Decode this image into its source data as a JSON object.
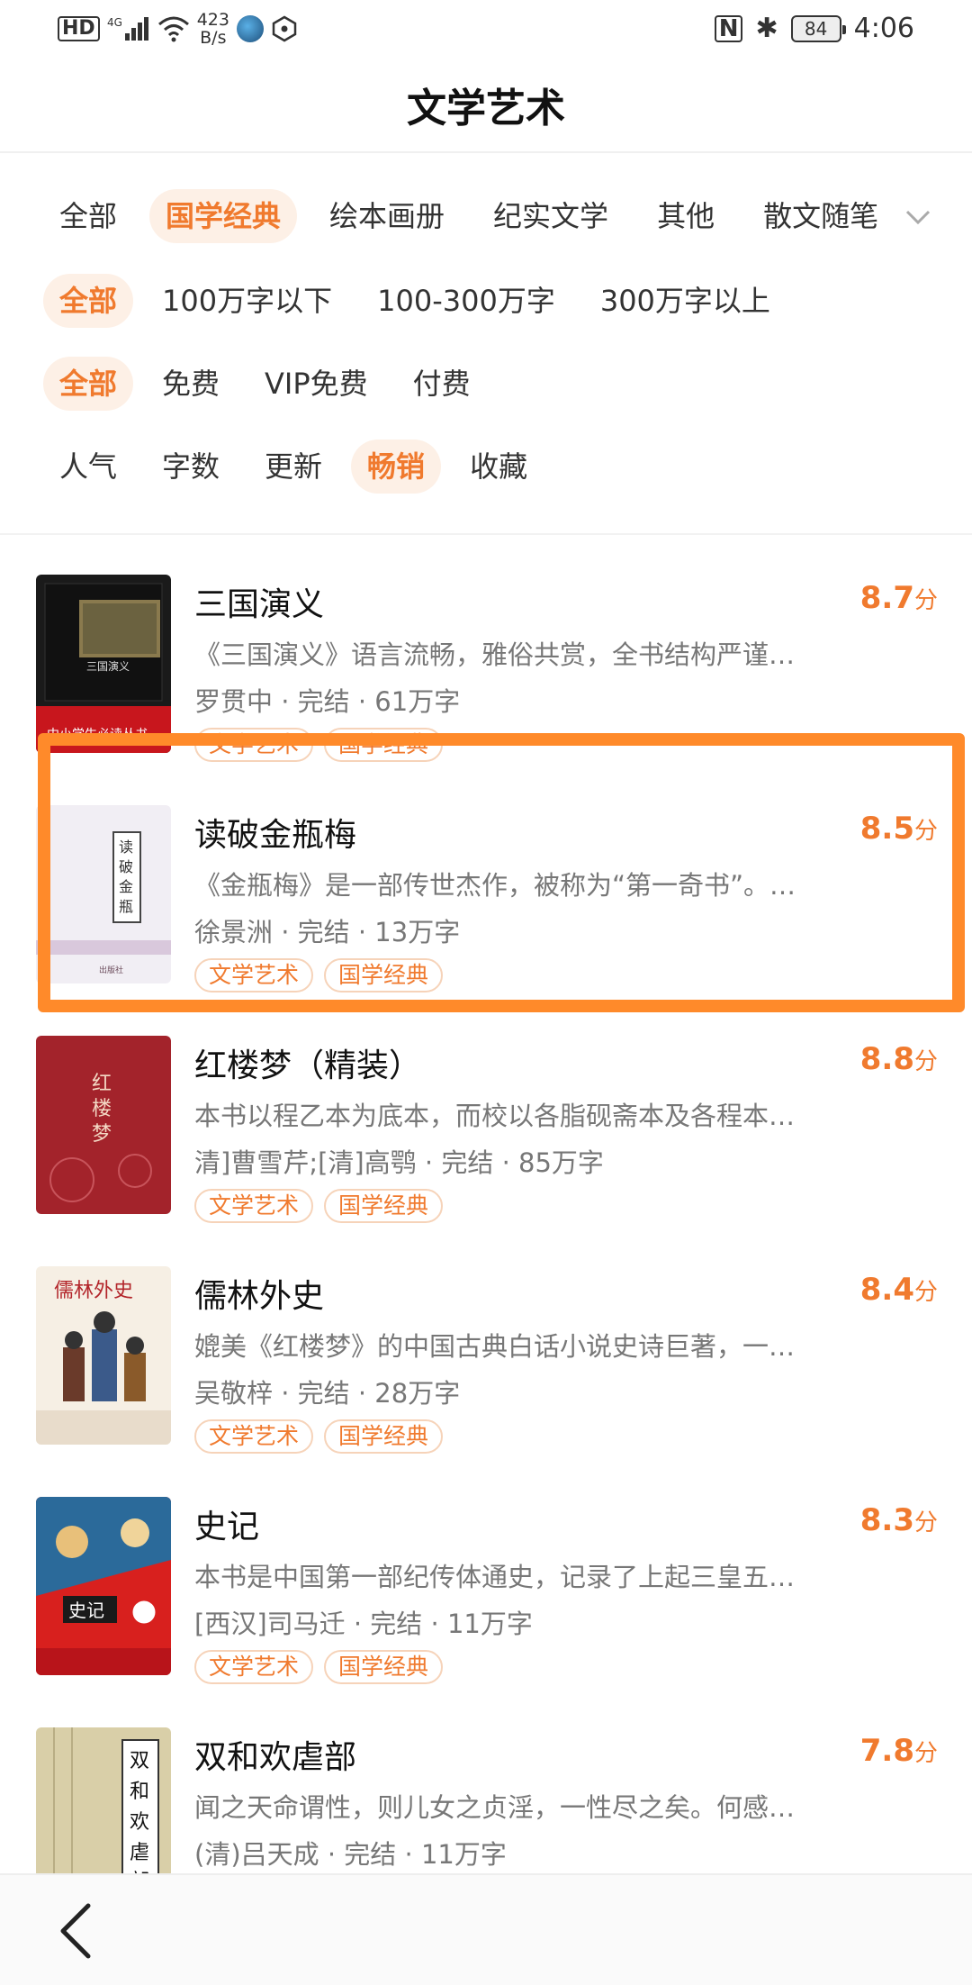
{
  "status_bar": {
    "network_badge": "HD",
    "network_type": "4G",
    "speed_value": "423",
    "speed_unit": "B/s",
    "nfc_label": "N",
    "bluetooth_glyph": "✱",
    "battery_level": "84",
    "time": "4:06"
  },
  "header": {
    "title": "文学艺术"
  },
  "filters": {
    "category": [
      "全部",
      "国学经典",
      "绘本画册",
      "纪实文学",
      "其他",
      "散文随笔"
    ],
    "word_count": [
      "全部",
      "100万字以下",
      "100-300万字",
      "300万字以上"
    ],
    "price": [
      "全部",
      "免费",
      "VIP免费",
      "付费"
    ],
    "sort": [
      "人气",
      "字数",
      "更新",
      "畅销",
      "收藏"
    ]
  },
  "books": [
    {
      "title": "三国演义",
      "score": "8.7",
      "score_unit": "分",
      "desc": "《三国演义》语言流畅，雅俗共赏，全书结构严谨…",
      "meta": "罗贯中 · 完结 · 61万字",
      "tags": [
        "文学艺术",
        "国学经典"
      ]
    },
    {
      "title": "读破金瓶梅",
      "score": "8.5",
      "score_unit": "分",
      "desc": "《金瓶梅》是一部传世杰作，被称为“第一奇书”。…",
      "meta": "徐景洲 · 完结 · 13万字",
      "tags": [
        "文学艺术",
        "国学经典"
      ]
    },
    {
      "title": "红楼梦（精装）",
      "score": "8.8",
      "score_unit": "分",
      "desc": "本书以程乙本为底本，而校以各脂砚斋本及各程本…",
      "meta": "清]曹雪芹;[清]高鹗 · 完结 · 85万字",
      "tags": [
        "文学艺术",
        "国学经典"
      ]
    },
    {
      "title": "儒林外史",
      "score": "8.4",
      "score_unit": "分",
      "desc": "媲美《红楼梦》的中国古典白话小说史诗巨著，一…",
      "meta": "吴敬梓 · 完结 · 28万字",
      "tags": [
        "文学艺术",
        "国学经典"
      ]
    },
    {
      "title": "史记",
      "score": "8.3",
      "score_unit": "分",
      "desc": "本书是中国第一部纪传体通史，记录了上起三皇五…",
      "meta": "[西汉]司马迁 · 完结 · 11万字",
      "tags": [
        "文学艺术",
        "国学经典"
      ]
    },
    {
      "title": "双和欢虐部",
      "score": "7.8",
      "score_unit": "分",
      "desc": "闻之天命谓性，则儿女之贞淫，一性尽之矣。何感…",
      "meta": "(清)吕天成 · 完结 · 11万字",
      "tags": []
    }
  ],
  "colors": {
    "accent": "#f07a2e",
    "accent_bg": "#fdf0e6",
    "highlight": "#ff8a2a"
  }
}
